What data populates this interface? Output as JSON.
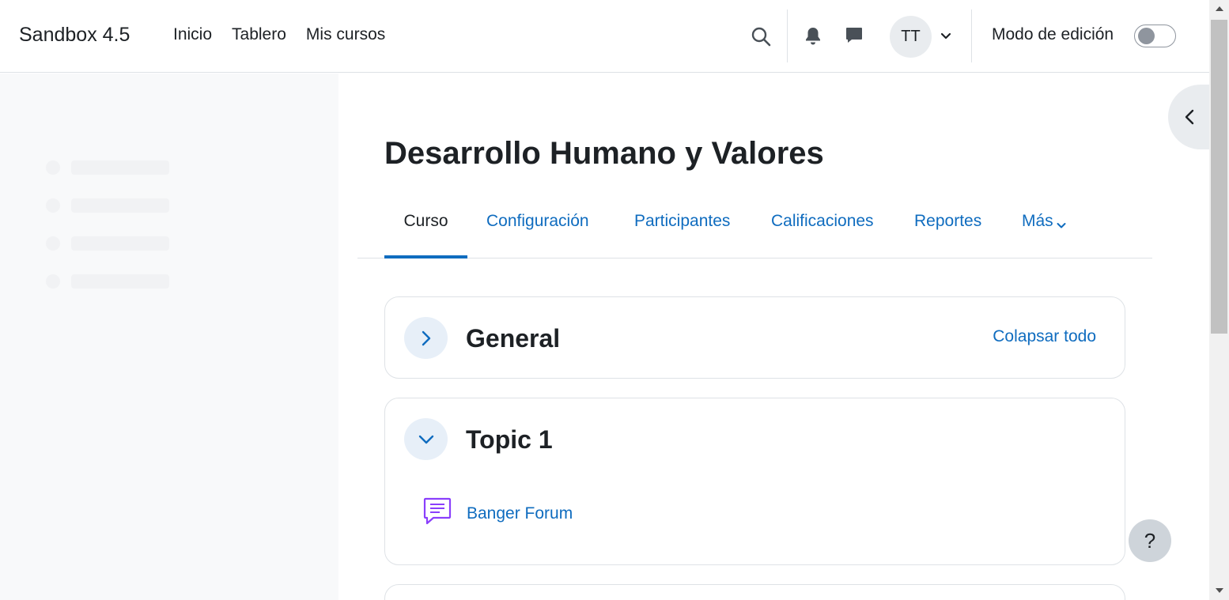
{
  "navbar": {
    "brand": "Sandbox 4.5",
    "links": [
      "Inicio",
      "Tablero",
      "Mis cursos"
    ],
    "avatar_initials": "TT",
    "edit_mode_label": "Modo de edición",
    "edit_mode_on": false
  },
  "course": {
    "title": "Desarrollo Humano y Valores"
  },
  "secondary_nav": {
    "tabs": [
      "Curso",
      "Configuración",
      "Participantes",
      "Calificaciones",
      "Reportes",
      "Más"
    ],
    "active": "Curso"
  },
  "sections": [
    {
      "title": "General",
      "expanded": false,
      "action": "Colapsar todo"
    },
    {
      "title": "Topic 1",
      "expanded": true,
      "activities": [
        {
          "name": "Banger Forum",
          "icon": "forum-icon"
        }
      ]
    }
  ],
  "help_button": "?",
  "colors": {
    "link": "#0f6cbf",
    "text": "#1d2125",
    "drawer_bg": "#f8f9fa",
    "forum_icon": "#8a3ffc"
  }
}
